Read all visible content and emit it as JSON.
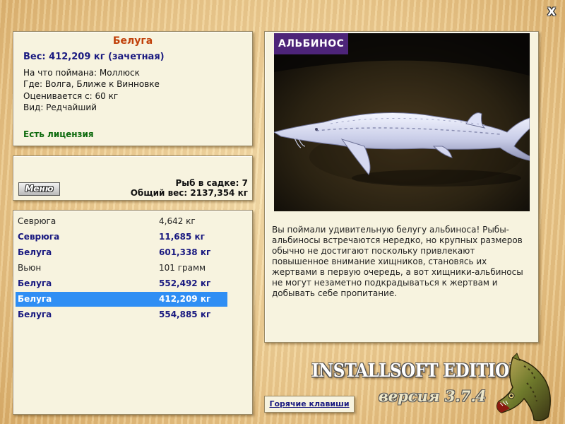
{
  "window": {
    "close_label": "X"
  },
  "info": {
    "fish_name": "Белуга",
    "weight": "Вес: 412,209 кг (зачетная)",
    "caught_on": "На что поймана: Моллюск",
    "where": "Где: Волга, Ближе к Винновке",
    "price": "Оценивается с: 60 кг",
    "kind": "Вид: Редчайший",
    "license": "Есть лицензия"
  },
  "menu": {
    "button_label": "Меню",
    "fish_count": "Рыб в садке: 7",
    "total_weight": "Общий вес: 2137,354 кг"
  },
  "catches": [
    {
      "name": "Севрюга",
      "weight": "4,642 кг",
      "bold": false
    },
    {
      "name": "Севрюга",
      "weight": "11,685 кг",
      "bold": true
    },
    {
      "name": "Белуга",
      "weight": "601,338 кг",
      "bold": true
    },
    {
      "name": "Вьюн",
      "weight": "101 грамм",
      "bold": false
    },
    {
      "name": "Белуга",
      "weight": "552,492 кг",
      "bold": true
    },
    {
      "name": "Белуга",
      "weight": "412,209 кг",
      "bold": true,
      "selected": true
    },
    {
      "name": "Белуга",
      "weight": "554,885 кг",
      "bold": true
    }
  ],
  "picture": {
    "badge": "АЛЬБИНОС",
    "description": "Вы поймали удивительную белугу альбиноса! Рыбы-альбиносы встречаются нередко, но крупных размеров обычно не достигают поскольку привлекают повышенное внимание хищников, становясь их жертвами в первую очередь, а вот хищники-альбиносы не могут незаметно подкрадываться к жертвам и добывать себе пропитание."
  },
  "branding": {
    "edition": "INSTALLSOFT EDITION",
    "version": "версия 3.7.4"
  },
  "hotkeys_label": "Горячие клавиши",
  "colors": {
    "selection": "#2f8ef4",
    "panel": "#f7f3df",
    "fish_name": "#c0400a",
    "bold_text": "#1a1a80",
    "license": "#0d6a0d",
    "badge": "#4d2479"
  }
}
